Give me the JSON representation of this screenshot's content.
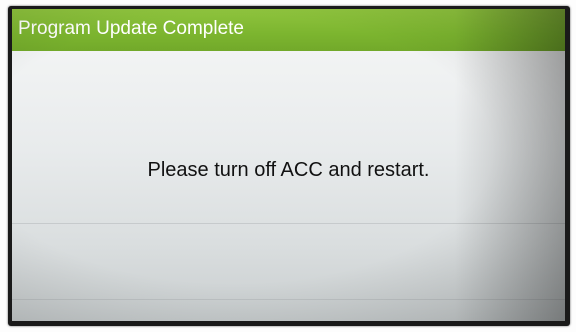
{
  "dialog": {
    "title": "Program Update Complete",
    "message": "Please turn off ACC and restart."
  },
  "colors": {
    "title_bar": "#7cb52f",
    "title_text": "#ffffff",
    "background": "#e8ebec",
    "message_text": "#111111"
  }
}
